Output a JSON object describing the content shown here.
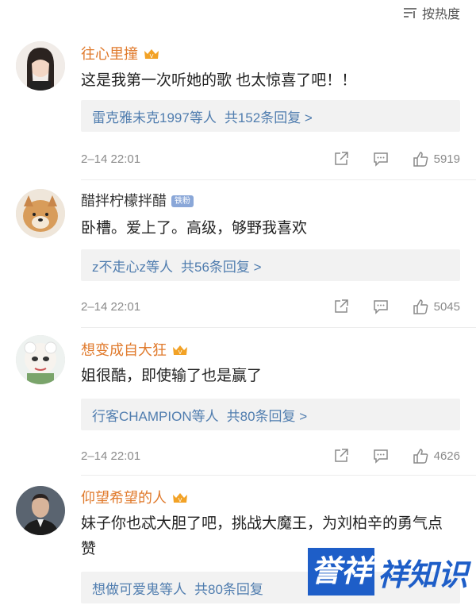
{
  "sort": {
    "label": "按热度"
  },
  "comments": [
    {
      "username": "往心里撞",
      "content": "这是我第一次听她的歌 也太惊喜了吧！！",
      "reply_names": "雷克雅未克1997等人",
      "reply_count": "共152条回复 >",
      "time": "2–14 22:01",
      "likes": "5919"
    },
    {
      "username": "醋拌柠檬拌醋",
      "badge": "铁粉",
      "content": "卧槽。爱上了。高级，够野我喜欢",
      "reply_names": "z不走心z等人",
      "reply_count": "共56条回复 >",
      "time": "2–14 22:01",
      "likes": "5045"
    },
    {
      "username": "想变成自大狂",
      "content": "姐很酷，即使输了也是赢了",
      "reply_names": "行客CHAMPION等人",
      "reply_count": "共80条回复 >",
      "time": "2–14 22:01",
      "likes": "4626"
    },
    {
      "username": "仰望希望的人",
      "content": "妹子你也忒大胆了吧，挑战大魔王，为刘柏辛的勇气点赞",
      "reply_names": "想做可爱鬼等人",
      "reply_count": "共80条回复"
    }
  ],
  "watermark": {
    "part1": "誉祥",
    "part2": "祥知识"
  },
  "colors": {
    "username": "#e07a2c",
    "link": "#507daf",
    "meta": "#8a8a8a"
  }
}
